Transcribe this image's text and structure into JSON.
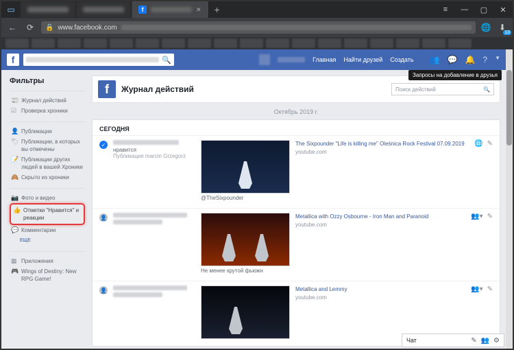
{
  "browser": {
    "url": "www.facebook.com",
    "sys_menu_glyph": "≡",
    "add_tab": "+",
    "win_min": "—",
    "win_max": "▢",
    "win_close": "✕",
    "nav_back": "←",
    "nav_reload": "⟳",
    "ext_translate": "🌐",
    "ext_download": "⬇"
  },
  "fb": {
    "logo": "f",
    "search_glyph": "🔍",
    "nav": {
      "home": "Главная",
      "find_friends": "Найти друзей",
      "create": "Создать"
    },
    "icons": {
      "friends": "👥",
      "msg": "💬",
      "bell": "🔔",
      "help": "?",
      "dd": "▼"
    },
    "tooltip": "Запросы на добавление в друзья"
  },
  "sidebar": {
    "title": "Фильтры",
    "g1": [
      {
        "icon": "📰",
        "label": "Журнал действий"
      },
      {
        "icon": "☑",
        "label": "Проверка хроники"
      }
    ],
    "g2": [
      {
        "icon": "👤",
        "label": "Публикации"
      },
      {
        "icon": "🏷",
        "label": "Публикации, в которых вы отмечены"
      },
      {
        "icon": "📝",
        "label": "Публикации других людей в вашей Хронике"
      },
      {
        "icon": "🙈",
        "label": "Скрыто из хроники"
      }
    ],
    "g3": [
      {
        "icon": "📷",
        "label": "Фото и видео"
      },
      {
        "icon": "👍",
        "label": "Отметки \"Нравится\" и реакции"
      },
      {
        "icon": "💬",
        "label": "Комментарии"
      }
    ],
    "g3_more": "ЕЩЕ",
    "g4": [
      {
        "icon": "▦",
        "label": "Приложения"
      },
      {
        "icon": "🎮",
        "label": "Wings of Destiny: New RPG Game!"
      }
    ]
  },
  "main": {
    "page_title": "Журнал действий",
    "search_placeholder": "Поиск действий",
    "month": "Октябрь 2019 г.",
    "section": "СЕГОДНЯ",
    "entries": [
      {
        "icon_type": "blue",
        "line2": "нравится",
        "line3": "Публикация marcin Grzegorz",
        "caption": "@TheSixpounder",
        "title": "The Sixpounder \"Life is killing me\" Oleśnica Rock Festival 07.09.2019",
        "source": "youtube.com",
        "privacy": "🌐"
      },
      {
        "icon_type": "gray",
        "caption": "Не менее крутой фьюжн",
        "title": "Metallica with Ozzy Osbourne - Iron Man and Paranoid",
        "source": "youtube.com",
        "privacy": "👥▾"
      },
      {
        "icon_type": "gray",
        "title": "Metallica and Lemmy",
        "source": "youtube.com",
        "privacy": "👥▾"
      }
    ]
  },
  "chat": {
    "label": "Чат",
    "edit": "✎",
    "add": "👥",
    "gear": "⚙"
  }
}
